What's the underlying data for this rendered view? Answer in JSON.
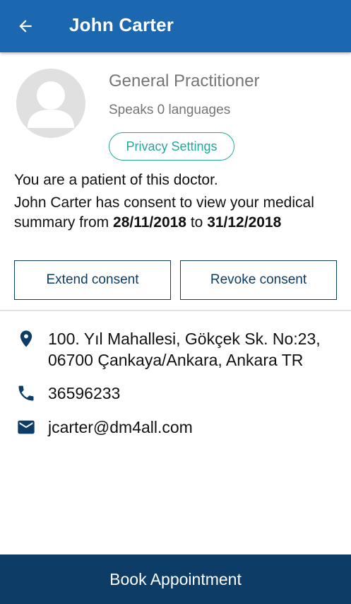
{
  "appbar": {
    "title": "John Carter",
    "back_icon": "arrow-left-icon",
    "background": "#1c68b0"
  },
  "profile": {
    "avatar_icon": "person-placeholder-icon",
    "specialty": "General Practitioner",
    "languages": "Speaks 0 languages",
    "privacy_button": "Privacy Settings"
  },
  "consent": {
    "status": "You are a patient of this doctor.",
    "detail_prefix": "John Carter has consent to view your medical summary from",
    "date_from": "28/11/2018",
    "detail_to": "to",
    "date_to": "31/12/2018",
    "extend_button": "Extend consent",
    "revoke_button": "Revoke consent"
  },
  "contact": {
    "address": "100. Yıl Mahallesi, Gökçek Sk. No:23, 06700 Çankaya/Ankara, Ankara TR",
    "address_icon": "location-pin-icon",
    "phone": "36596233",
    "phone_icon": "phone-icon",
    "email": "jcarter@dm4all.com",
    "email_icon": "mail-icon",
    "icon_color": "#0d3d66"
  },
  "footer": {
    "book_button": "Book Appointment",
    "background": "#0d3d66"
  }
}
